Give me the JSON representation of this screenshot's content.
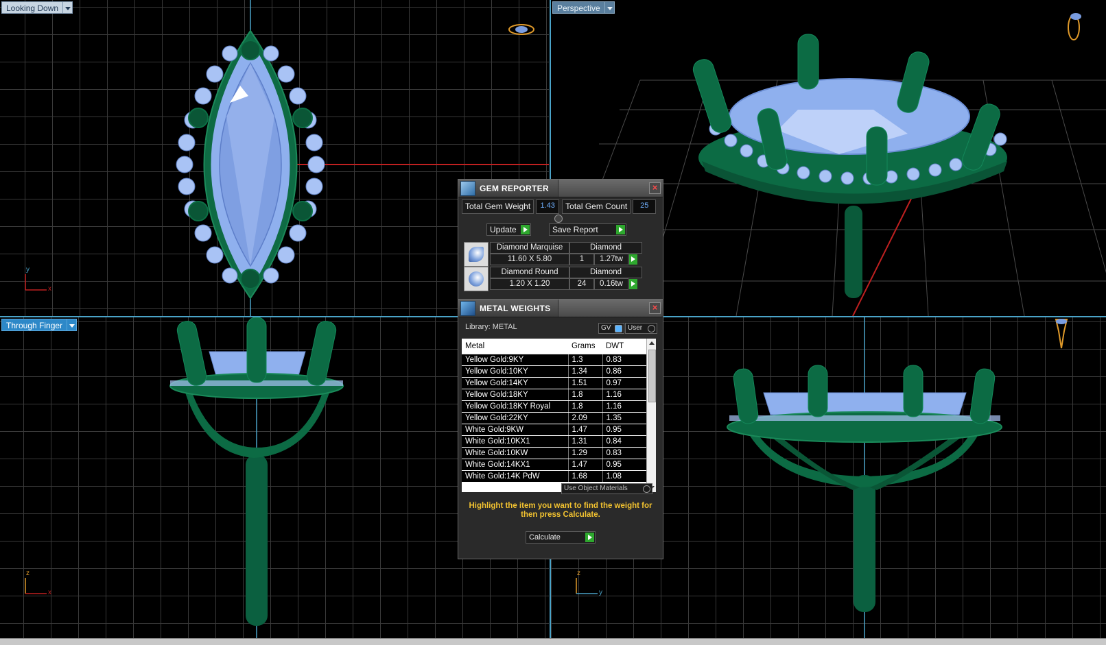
{
  "viewports": {
    "top_left_label": "Looking Down",
    "top_right_label": "Perspective",
    "bottom_left_label": "Through Finger",
    "axes": {
      "top_left": [
        "y",
        "x"
      ],
      "bottom_left": [
        "z",
        "x"
      ],
      "bottom_right": [
        "z",
        "y"
      ]
    }
  },
  "gem_reporter": {
    "title": "GEM REPORTER",
    "total_weight_label": "Total Gem Weight",
    "total_weight_value": "1.43",
    "total_count_label": "Total Gem Count",
    "total_count_value": "25",
    "update_label": "Update",
    "save_report_label": "Save Report",
    "gems": [
      {
        "name": "Diamond Marquise",
        "material": "Diamond",
        "size": "11.60 X 5.80",
        "count": "1",
        "weight": "1.27tw"
      },
      {
        "name": "Diamond Round",
        "material": "Diamond",
        "size": "1.20 X 1.20",
        "count": "24",
        "weight": "0.16tw"
      }
    ]
  },
  "metal_weights": {
    "title": "METAL WEIGHTS",
    "library_label": "Library: METAL",
    "gv_label": "GV",
    "user_label": "User",
    "columns": [
      "Metal",
      "Grams",
      "DWT"
    ],
    "rows": [
      [
        "Yellow Gold:9KY",
        "1.3",
        "0.83"
      ],
      [
        "Yellow Gold:10KY",
        "1.34",
        "0.86"
      ],
      [
        "Yellow Gold:14KY",
        "1.51",
        "0.97"
      ],
      [
        "Yellow Gold:18KY",
        "1.8",
        "1.16"
      ],
      [
        "Yellow Gold:18KY Royal",
        "1.8",
        "1.16"
      ],
      [
        "Yellow Gold:22KY",
        "2.09",
        "1.35"
      ],
      [
        "White Gold:9KW",
        "1.47",
        "0.95"
      ],
      [
        "White Gold:10KX1",
        "1.31",
        "0.84"
      ],
      [
        "White Gold:10KW",
        "1.29",
        "0.83"
      ],
      [
        "White Gold:14KX1",
        "1.47",
        "0.95"
      ],
      [
        "White Gold:14K PdW",
        "1.68",
        "1.08"
      ]
    ],
    "use_object_materials_label": "Use Object Materials",
    "hint_text": "Highlight the item you want to find the weight for then press Calculate.",
    "calculate_label": "Calculate"
  },
  "colors": {
    "accent_border": "#4aa3c8",
    "prong_green": "#0e6b44",
    "gem_blue": "#8fb0ee",
    "hint_yellow": "#f2c230",
    "go_green": "#2ea82e"
  }
}
